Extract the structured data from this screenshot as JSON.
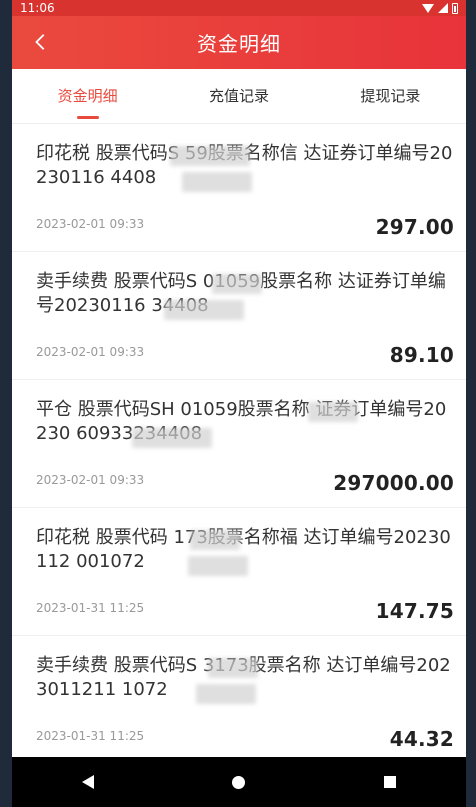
{
  "status_bar": {
    "time": "11:06"
  },
  "header": {
    "title": "资金明细",
    "back_icon": "chevron-left-icon"
  },
  "tabs": [
    {
      "label": "资金明细",
      "active": true
    },
    {
      "label": "充值记录",
      "active": false
    },
    {
      "label": "提现记录",
      "active": false
    }
  ],
  "records": [
    {
      "desc": "印花税 股票代码S      59股票名称信  达证券订单编号20230116     4408",
      "date": "2023-02-01 09:33",
      "amount": "297.00"
    },
    {
      "desc": "卖手续费 股票代码S   01059股票名称    达证券订单编号20230116    34408",
      "date": "2023-02-01 09:33",
      "amount": "89.10"
    },
    {
      "desc": "平仓 股票代码SH 01059股票名称   证券订单编号20230     60933234408",
      "date": "2023-02-01 09:33",
      "amount": "297000.00"
    },
    {
      "desc": "印花税 股票代码    173股票名称福  达订单编号20230112     001072",
      "date": "2023-01-31 11:25",
      "amount": "147.75"
    },
    {
      "desc": "卖手续费 股票代码S   3173股票名称    达订单编号2023011211     1072",
      "date": "2023-01-31 11:25",
      "amount": "44.32"
    }
  ],
  "colors": {
    "accent": "#e84a3e",
    "header": "#e8333a"
  }
}
